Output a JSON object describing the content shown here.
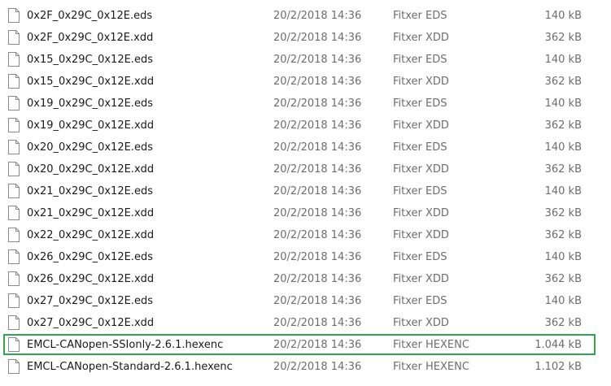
{
  "files": [
    {
      "name": "0x2F_0x29C_0x12E.eds",
      "date": "20/2/2018 14:36",
      "type": "Fitxer EDS",
      "size": "140 kB",
      "icon": "document-icon"
    },
    {
      "name": "0x2F_0x29C_0x12E.xdd",
      "date": "20/2/2018 14:36",
      "type": "Fitxer XDD",
      "size": "362 kB",
      "icon": "document-icon"
    },
    {
      "name": "0x15_0x29C_0x12E.eds",
      "date": "20/2/2018 14:36",
      "type": "Fitxer EDS",
      "size": "140 kB",
      "icon": "document-icon"
    },
    {
      "name": "0x15_0x29C_0x12E.xdd",
      "date": "20/2/2018 14:36",
      "type": "Fitxer XDD",
      "size": "362 kB",
      "icon": "document-icon"
    },
    {
      "name": "0x19_0x29C_0x12E.eds",
      "date": "20/2/2018 14:36",
      "type": "Fitxer EDS",
      "size": "140 kB",
      "icon": "document-icon"
    },
    {
      "name": "0x19_0x29C_0x12E.xdd",
      "date": "20/2/2018 14:36",
      "type": "Fitxer XDD",
      "size": "362 kB",
      "icon": "document-icon"
    },
    {
      "name": "0x20_0x29C_0x12E.eds",
      "date": "20/2/2018 14:36",
      "type": "Fitxer EDS",
      "size": "140 kB",
      "icon": "document-icon"
    },
    {
      "name": "0x20_0x29C_0x12E.xdd",
      "date": "20/2/2018 14:36",
      "type": "Fitxer XDD",
      "size": "362 kB",
      "icon": "document-icon"
    },
    {
      "name": "0x21_0x29C_0x12E.eds",
      "date": "20/2/2018 14:36",
      "type": "Fitxer EDS",
      "size": "140 kB",
      "icon": "document-icon"
    },
    {
      "name": "0x21_0x29C_0x12E.xdd",
      "date": "20/2/2018 14:36",
      "type": "Fitxer XDD",
      "size": "362 kB",
      "icon": "document-icon"
    },
    {
      "name": "0x22_0x29C_0x12E.xdd",
      "date": "20/2/2018 14:36",
      "type": "Fitxer XDD",
      "size": "362 kB",
      "icon": "document-icon"
    },
    {
      "name": "0x26_0x29C_0x12E.eds",
      "date": "20/2/2018 14:36",
      "type": "Fitxer EDS",
      "size": "140 kB",
      "icon": "document-icon"
    },
    {
      "name": "0x26_0x29C_0x12E.xdd",
      "date": "20/2/2018 14:36",
      "type": "Fitxer XDD",
      "size": "362 kB",
      "icon": "document-icon"
    },
    {
      "name": "0x27_0x29C_0x12E.eds",
      "date": "20/2/2018 14:36",
      "type": "Fitxer EDS",
      "size": "140 kB",
      "icon": "document-icon"
    },
    {
      "name": "0x27_0x29C_0x12E.xdd",
      "date": "20/2/2018 14:36",
      "type": "Fitxer XDD",
      "size": "362 kB",
      "icon": "document-icon"
    },
    {
      "name": "EMCL-CANopen-SSIonly-2.6.1.hexenc",
      "date": "20/2/2018 14:36",
      "type": "Fitxer HEXENC",
      "size": "1.044 kB",
      "icon": "document-icon",
      "selected": true
    },
    {
      "name": "EMCL-CANopen-Standard-2.6.1.hexenc",
      "date": "20/2/2018 14:36",
      "type": "Fitxer HEXENC",
      "size": "1.102 kB",
      "icon": "document-icon"
    }
  ],
  "colors": {
    "name_text": "#1a1a1a",
    "detail_text": "#6d6d6d",
    "selection_border": "#2da84a"
  }
}
